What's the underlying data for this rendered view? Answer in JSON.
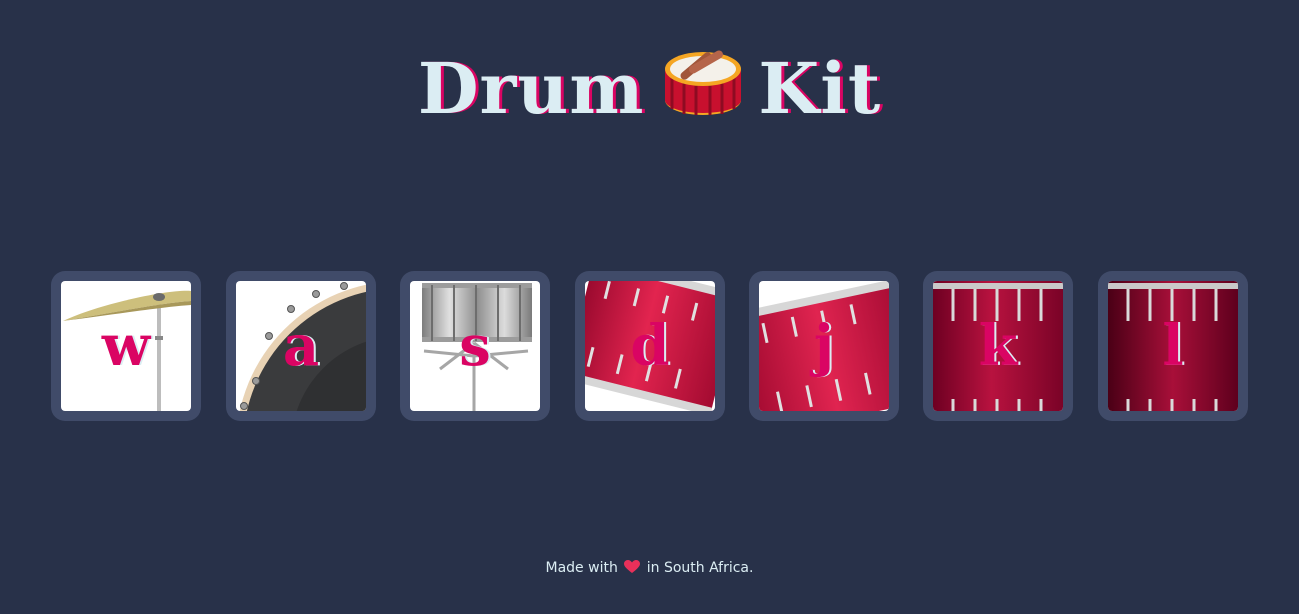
{
  "header": {
    "title_before": "Drum",
    "title_after": "Kit",
    "icon": "drum-icon"
  },
  "drums": [
    {
      "key": "w",
      "instrument_icon": "crash-cymbal-icon"
    },
    {
      "key": "a",
      "instrument_icon": "kick-drum-icon"
    },
    {
      "key": "s",
      "instrument_icon": "snare-drum-icon"
    },
    {
      "key": "d",
      "instrument_icon": "tom-drum-icon"
    },
    {
      "key": "j",
      "instrument_icon": "tom-drum-icon"
    },
    {
      "key": "k",
      "instrument_icon": "floor-tom-icon"
    },
    {
      "key": "l",
      "instrument_icon": "floor-tom-icon"
    }
  ],
  "footer": {
    "text_before": "Made with",
    "text_after": "in South Africa.",
    "icon": "heart-icon"
  },
  "colors": {
    "background": "#283149",
    "key_frame": "#404b69",
    "accent": "#da0463",
    "text": "#dbedf3"
  }
}
